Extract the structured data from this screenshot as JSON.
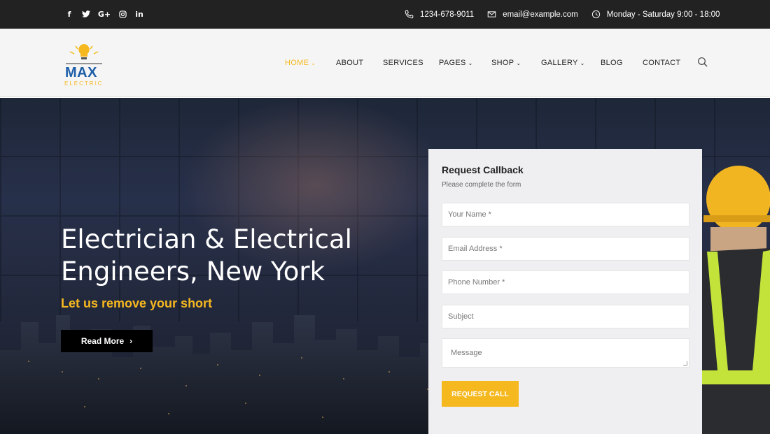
{
  "topbar": {
    "social": [
      {
        "icon": "facebook-icon",
        "glyph": "f"
      },
      {
        "icon": "twitter-icon",
        "glyph": "t"
      },
      {
        "icon": "google-plus-icon",
        "glyph": "G+"
      },
      {
        "icon": "instagram-icon",
        "glyph": "◎"
      },
      {
        "icon": "linkedin-icon",
        "glyph": "in"
      }
    ],
    "phone": "1234-678-9011",
    "email": "email@example.com",
    "hours": "Monday - Saturday 9:00 - 18:00"
  },
  "logo": {
    "name": "MAX",
    "tagline": "ELECTRIC"
  },
  "nav": {
    "items": [
      {
        "label": "HOME",
        "has_dropdown": true,
        "active": true
      },
      {
        "label": "ABOUT",
        "has_dropdown": false
      },
      {
        "label": "SERVICES",
        "has_dropdown": false
      },
      {
        "label": "PAGES",
        "has_dropdown": true
      },
      {
        "label": "SHOP",
        "has_dropdown": true
      },
      {
        "label": "GALLERY",
        "has_dropdown": true
      },
      {
        "label": "BLOG",
        "has_dropdown": false
      },
      {
        "label": "CONTACT",
        "has_dropdown": false
      }
    ],
    "chevron": "⌄"
  },
  "hero": {
    "title_line1": "Electrician & Electrical",
    "title_line2": "Engineers, New York",
    "subtitle": "Let us remove your short",
    "button_label": "Read More",
    "button_arrow": "›"
  },
  "form": {
    "title": "Request Callback",
    "subtitle": "Please complete the form",
    "fields": {
      "name": "Your Name *",
      "email": "Email Address *",
      "phone": "Phone Number *",
      "subject": "Subject",
      "message": "Message"
    },
    "submit_label": "REQUEST CALL"
  },
  "colors": {
    "accent": "#f6b81f",
    "topbar": "#222222",
    "brand_blue": "#1c5ea8"
  }
}
